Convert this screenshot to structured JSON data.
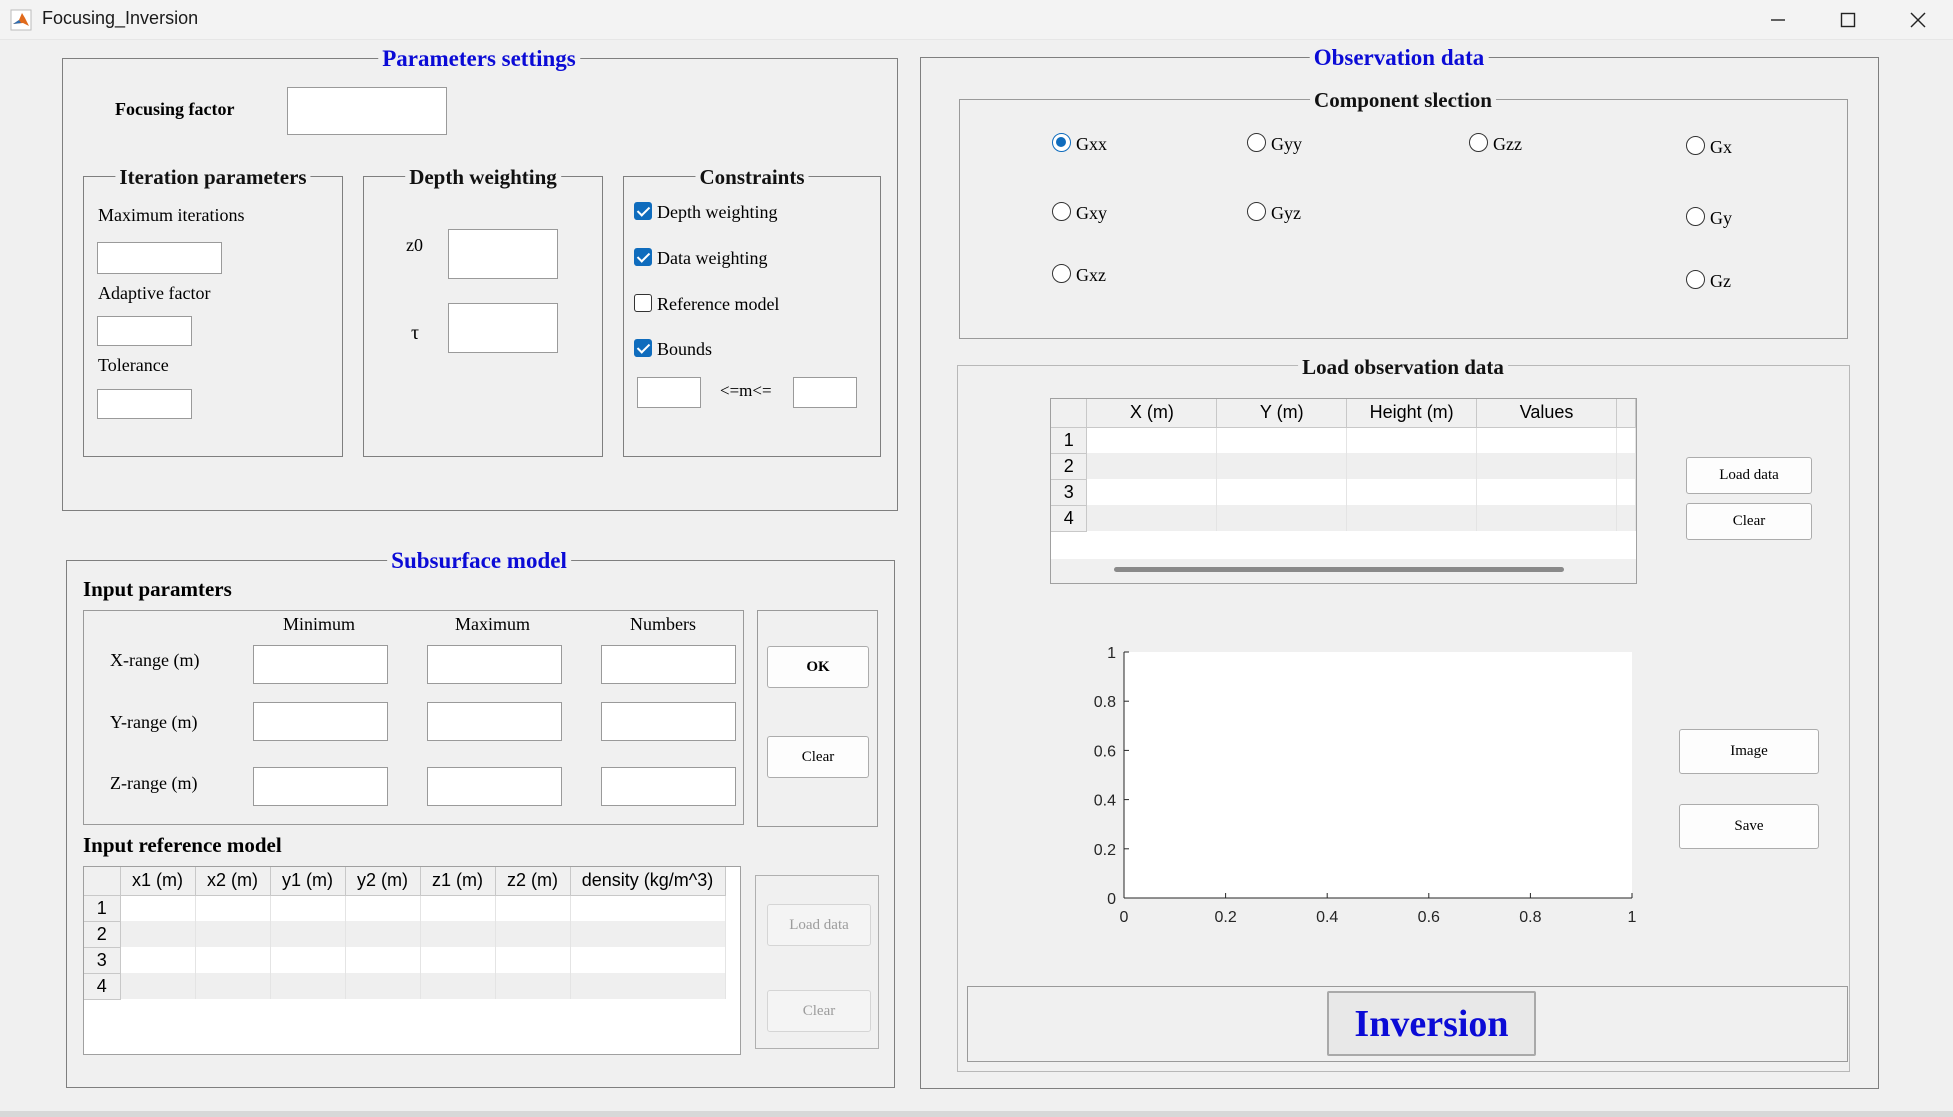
{
  "window": {
    "title": "Focusing_Inversion",
    "icon": "matlab-icon"
  },
  "parameters": {
    "title": "Parameters settings",
    "focusing_factor_label": "Focusing factor",
    "focusing_factor_value": "",
    "iteration": {
      "title": "Iteration parameters",
      "max_iter_label": "Maximum iterations",
      "adaptive_label": "Adaptive factor",
      "tolerance_label": "Tolerance"
    },
    "depth": {
      "title": "Depth weighting",
      "z0_label": "z0",
      "tau_label": "τ"
    },
    "constraints": {
      "title": "Constraints",
      "items": [
        {
          "label": "Depth weighting",
          "checked": true
        },
        {
          "label": "Data weighting",
          "checked": true
        },
        {
          "label": "Reference model",
          "checked": false
        },
        {
          "label": "Bounds",
          "checked": true
        }
      ],
      "bounds_mid": "<=m<="
    }
  },
  "subsurface": {
    "title": "Subsurface model",
    "input_title": "Input paramters",
    "col_headers": [
      "Minimum",
      "Maximum",
      "Numbers"
    ],
    "rows": [
      "X-range (m)",
      "Y-range (m)",
      "Z-range (m)"
    ],
    "ok_label": "OK",
    "clear_label": "Clear",
    "ref_title": "Input reference model",
    "ref_headers": [
      "x1 (m)",
      "x2 (m)",
      "y1 (m)",
      "y2 (m)",
      "z1 (m)",
      "z2 (m)",
      "density (kg/m^3)"
    ],
    "ref_rows": [
      "1",
      "2",
      "3",
      "4"
    ],
    "ref_load_label": "Load data",
    "ref_clear_label": "Clear"
  },
  "observation": {
    "title": "Observation data",
    "component_title": "Component slection",
    "components": [
      {
        "label": "Gxx",
        "selected": true
      },
      {
        "label": "Gyy",
        "selected": false
      },
      {
        "label": "Gzz",
        "selected": false
      },
      {
        "label": "Gx",
        "selected": false
      },
      {
        "label": "Gxy",
        "selected": false
      },
      {
        "label": "Gyz",
        "selected": false
      },
      {
        "label": "Gy",
        "selected": false
      },
      {
        "label": "Gxz",
        "selected": false
      },
      {
        "label": "Gz",
        "selected": false
      }
    ],
    "load_title": "Load observation data",
    "load_headers": [
      "X (m)",
      "Y (m)",
      "Height (m)",
      "Values"
    ],
    "load_rows": [
      "1",
      "2",
      "3",
      "4"
    ],
    "load_label": "Load data",
    "clear_label": "Clear",
    "image_label": "Image",
    "save_label": "Save",
    "inversion_label": "Inversion"
  },
  "chart_data": {
    "type": "scatter",
    "title": "",
    "xlabel": "",
    "ylabel": "",
    "xlim": [
      0,
      1
    ],
    "ylim": [
      0,
      1
    ],
    "xticks": [
      "0",
      "0.2",
      "0.4",
      "0.6",
      "0.8",
      "1"
    ],
    "yticks": [
      "0",
      "0.2",
      "0.4",
      "0.6",
      "0.8",
      "1"
    ],
    "series": []
  },
  "colors": {
    "title_blue": "#0b0bd6",
    "accent": "#0f6cbd",
    "background": "#f0f0f0"
  }
}
